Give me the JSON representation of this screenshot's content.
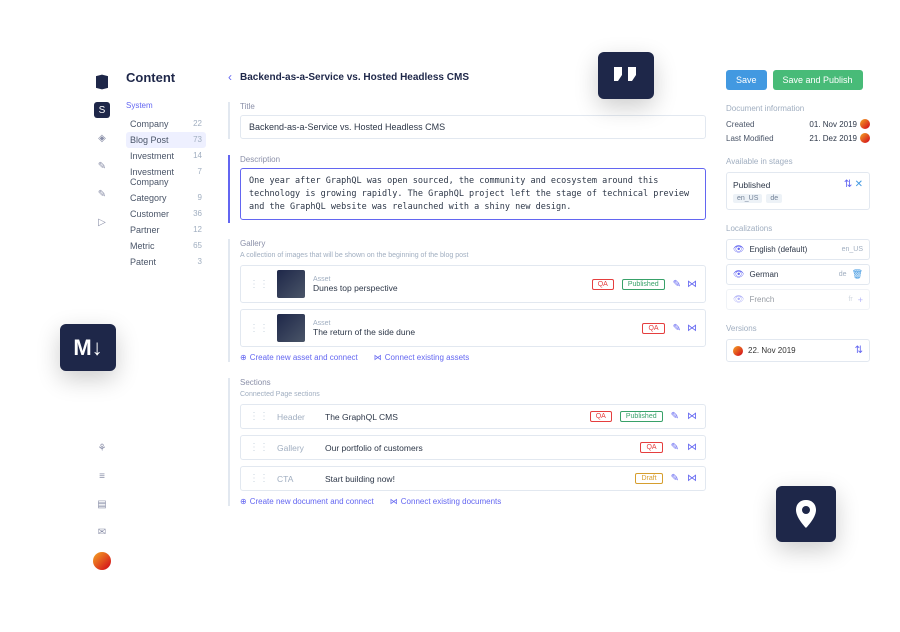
{
  "header": {
    "title": "Content",
    "breadcrumb": "Backend-as-a-Service vs. Hosted Headless CMS"
  },
  "sidebar": {
    "section_label": "System",
    "items": [
      {
        "label": "Company",
        "count": "22"
      },
      {
        "label": "Blog Post",
        "count": "73"
      },
      {
        "label": "Investment",
        "count": "14"
      },
      {
        "label": "Investment Company",
        "count": "7"
      },
      {
        "label": "Category",
        "count": "9"
      },
      {
        "label": "Customer",
        "count": "36"
      },
      {
        "label": "Partner",
        "count": "12"
      },
      {
        "label": "Metric",
        "count": "65"
      },
      {
        "label": "Patent",
        "count": "3"
      }
    ]
  },
  "fields": {
    "title_label": "Title",
    "title_value": "Backend-as-a-Service vs. Hosted Headless CMS",
    "description_label": "Description",
    "description_value": "One year after GraphQL was open sourced, the community and ecosystem around this technology is growing rapidly. The GraphQL project left the stage of technical preview and the GraphQL website was relaunched with a shiny new design.",
    "gallery_label": "Gallery",
    "gallery_sublabel": "A collection of images that will be shown on the beginning of the blog post",
    "assets": [
      {
        "type": "Asset",
        "title": "Dunes top perspective",
        "badges": [
          "QA",
          "Published"
        ]
      },
      {
        "type": "Asset",
        "title": "The return of the side dune",
        "badges": [
          "QA"
        ]
      }
    ],
    "create_asset": "Create new asset and connect",
    "connect_assets": "Connect existing assets",
    "sections_label": "Sections",
    "sections_sublabel": "Connected Page sections",
    "sections": [
      {
        "type": "Header",
        "title": "The GraphQL CMS",
        "badges": [
          "QA",
          "Published"
        ]
      },
      {
        "type": "Gallery",
        "title": "Our portfolio of customers",
        "badges": [
          "QA"
        ]
      },
      {
        "type": "CTA",
        "title": "Start building now!",
        "badges": [
          "Draft"
        ]
      }
    ],
    "create_doc": "Create new document and connect",
    "connect_docs": "Connect existing documents"
  },
  "actions": {
    "save": "Save",
    "save_publish": "Save and Publish"
  },
  "doc_info": {
    "label": "Document information",
    "created_key": "Created",
    "created_val": "01. Nov 2019",
    "modified_key": "Last Modified",
    "modified_val": "21. Dez 2019"
  },
  "stages": {
    "label": "Available in stages",
    "name": "Published",
    "tags": [
      "en_US",
      "de"
    ]
  },
  "locales": {
    "label": "Localizations",
    "items": [
      {
        "name": "English (default)",
        "code": "en_US",
        "action": ""
      },
      {
        "name": "German",
        "code": "de",
        "action": "delete"
      },
      {
        "name": "French",
        "code": "fr",
        "action": "add"
      }
    ]
  },
  "versions": {
    "label": "Versions",
    "date": "22. Nov 2019"
  },
  "badges": {
    "qa": "QA",
    "published": "Published",
    "draft": "Draft"
  }
}
